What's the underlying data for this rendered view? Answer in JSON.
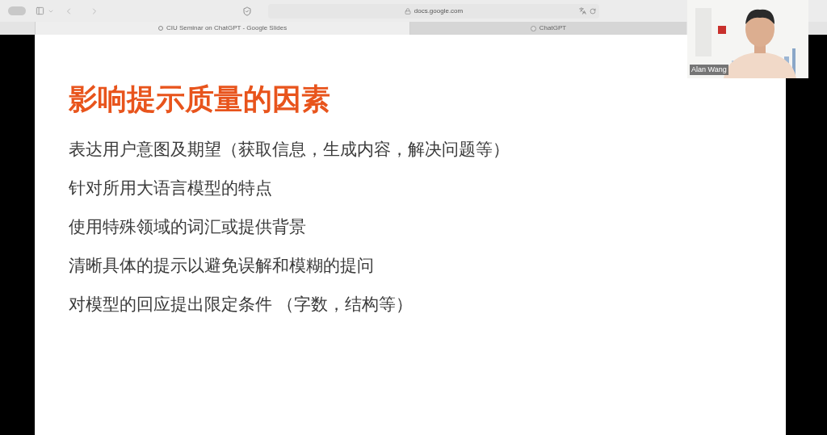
{
  "browser": {
    "address": "docs.google.com",
    "tabs": [
      {
        "label": "CIU Seminar on ChatGPT - Google Slides",
        "selected": true
      },
      {
        "label": "ChatGPT",
        "selected": false
      }
    ]
  },
  "slide": {
    "title": "影响提示质量的因素",
    "bullets": [
      "表达用户意图及期望（获取信息，生成内容，解决问题等）",
      "针对所用大语言模型的特点",
      "使用特殊领域的词汇或提供背景",
      "清晰具体的提示以避免误解和模糊的提问",
      "对模型的回应提出限定条件 （字数，结构等）"
    ]
  },
  "video": {
    "participant": "Alan Wang"
  }
}
